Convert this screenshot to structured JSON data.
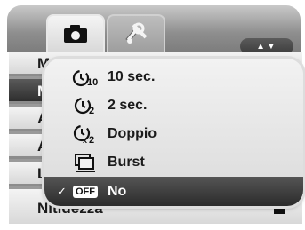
{
  "tabs": [
    {
      "name": "camera",
      "icon": "camera-icon",
      "active": true
    },
    {
      "name": "setup",
      "icon": "wrench-icon",
      "active": false
    }
  ],
  "nav_arrows": "▲▼",
  "menu_rows": [
    {
      "label": "M"
    },
    {
      "label": "M"
    },
    {
      "label": "A"
    },
    {
      "label": "A"
    },
    {
      "label": "L"
    },
    {
      "label": "Nitidezza"
    }
  ],
  "selected_menu_row_index": 1,
  "popup": {
    "options": [
      {
        "label": "10 sec.",
        "icon": "self-timer-10s-icon"
      },
      {
        "label": "2 sec.",
        "icon": "self-timer-2s-icon"
      },
      {
        "label": "Doppio",
        "icon": "self-timer-double-icon"
      },
      {
        "label": "Burst",
        "icon": "burst-icon"
      },
      {
        "label": "No",
        "icon": "off-icon",
        "badge": "OFF",
        "checked": true
      }
    ],
    "check_mark": "✓"
  },
  "colors": {
    "selected_bg": "#333333",
    "tab_strip": "#8e8e8e"
  }
}
